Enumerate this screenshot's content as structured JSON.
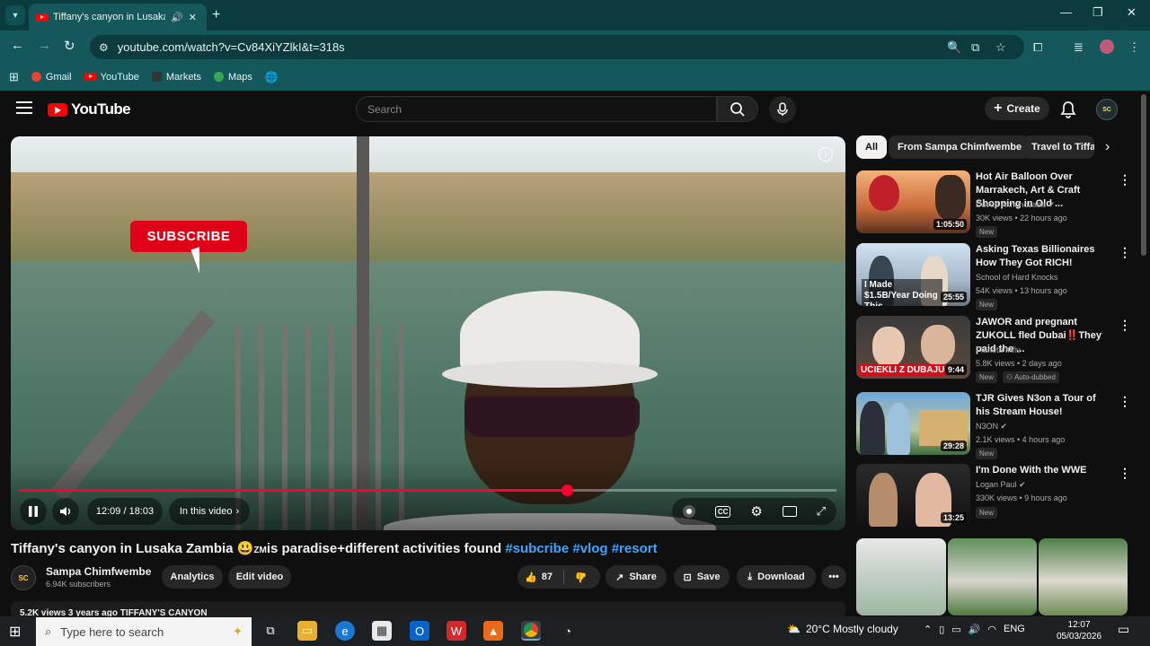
{
  "browser": {
    "tab_title": "Tiffany's canyon in Lusaka Z",
    "url": "youtube.com/watch?v=Cv84XiYZlkI&t=318s",
    "bookmarks": [
      {
        "label": "Gmail",
        "color": "#ea4335"
      },
      {
        "label": "YouTube",
        "color": "#ff0000"
      },
      {
        "label": "Markets",
        "color": "#333333"
      },
      {
        "label": "Maps",
        "color": "#34a853"
      }
    ]
  },
  "youtube": {
    "logo": "YouTube",
    "search_placeholder": "Search",
    "create_label": "Create",
    "avatar_text": "SC"
  },
  "player": {
    "subscribe_overlay": "SUBSCRIBE",
    "time": "12:09 / 18:03",
    "in_video_label": "In this video",
    "progress_fraction": 0.67
  },
  "video": {
    "title_prefix": "Tiffany's canyon in Lusaka Zambia 😃",
    "title_z": "ZM",
    "title_rest": "is paradise+different activities found ",
    "tags": "#subcribe #vlog #resort",
    "channel": "Sampa Chimfwembe",
    "subs": "6.94K subscribers",
    "analytics": "Analytics",
    "edit": "Edit video",
    "likes": "87",
    "share": "Share",
    "save": "Save",
    "download": "Download",
    "stats": "5.2K views  3 years ago  TIFFANY'S CANYON",
    "channel_avatar": "SC"
  },
  "chips": [
    "All",
    "From Sampa Chimfwembe",
    "Travel to Tiffa"
  ],
  "recommendations": [
    {
      "title": "Hot Air Balloon Over Marrakech, Art & Craft Shopping in Old ...",
      "channel": "Davud Akhundzada",
      "meta": "30K views • 22 hours ago",
      "badge": "New",
      "duration": "1:05:50",
      "verified": true,
      "thumb_overlay": ""
    },
    {
      "title": "Asking Texas Billionaires How They Got RICH!",
      "channel": "School of Hard Knocks",
      "meta": "54K views • 13 hours ago",
      "badge": "New",
      "duration": "25:55",
      "verified": false,
      "thumb_overlay": "I Made $1.5B/Year Doing This"
    },
    {
      "title": "JAWOR and pregnant ZUKOLL fled Dubai‼️They paid the ...",
      "channel": "Planeta Influ",
      "meta": "5.8K views • 2 days ago",
      "badge": "New",
      "badge2": "Auto-dubbed",
      "duration": "9:44",
      "verified": false,
      "thumb_overlay": "UCIEKLI Z DUBAJU"
    },
    {
      "title": "TJR Gives N3on a Tour of his Stream House!",
      "channel": "N3ON",
      "meta": "2.1K views • 4 hours ago",
      "badge": "New",
      "duration": "29:28",
      "verified": true,
      "thumb_overlay": ""
    },
    {
      "title": "I'm Done With the WWE",
      "channel": "Logan Paul",
      "meta": "330K views • 9 hours ago",
      "badge": "New",
      "duration": "13:25",
      "verified": true,
      "thumb_overlay": ""
    }
  ],
  "taskbar": {
    "search_placeholder": "Type here to search",
    "weather": "20°C  Mostly cloudy",
    "lang": "ENG",
    "time": "12:07",
    "date": "05/03/2026"
  }
}
